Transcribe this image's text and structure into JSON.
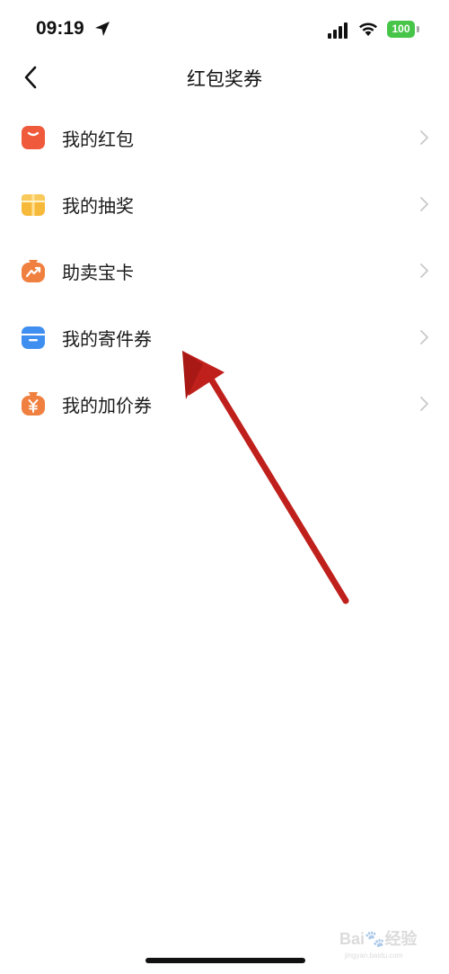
{
  "status_bar": {
    "time": "09:19",
    "battery_level": "100",
    "icons": [
      "location-arrow-icon",
      "cellular-signal-icon",
      "wifi-icon",
      "battery-icon"
    ],
    "battery_color": "#47c549"
  },
  "nav": {
    "title": "红包奖券",
    "back_icon": "chevron-left-icon"
  },
  "list": {
    "items": [
      {
        "label": "我的红包",
        "icon": "red-envelope-icon",
        "color": "#ef5a3c"
      },
      {
        "label": "我的抽奖",
        "icon": "gift-box-icon",
        "color": "#f7b93a"
      },
      {
        "label": "助卖宝卡",
        "icon": "trend-bag-icon",
        "color": "#f0803f"
      },
      {
        "label": "我的寄件券",
        "icon": "package-box-icon",
        "color": "#3f8ff0"
      },
      {
        "label": "我的加价券",
        "icon": "yuan-bag-icon",
        "color": "#f0803f"
      }
    ],
    "chevron_icon": "chevron-right-icon",
    "chevron_color": "#c8c8c8"
  },
  "annotation": {
    "arrow_color": "#c0201c"
  },
  "watermark": {
    "brand": "Bai",
    "brand_suffix": "经验",
    "url": "jingyan.baidu.com"
  }
}
